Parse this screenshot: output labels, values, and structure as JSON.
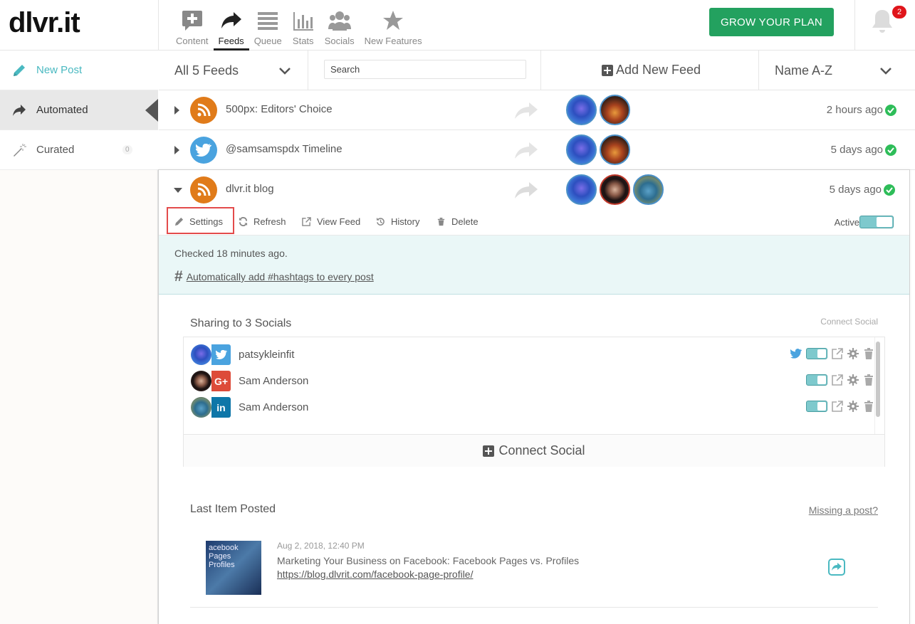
{
  "app": {
    "logo": "dlvr.it"
  },
  "nav": {
    "items": [
      {
        "label": "Content",
        "icon": "content-plus-icon"
      },
      {
        "label": "Feeds",
        "icon": "share-arrow-icon",
        "active": true
      },
      {
        "label": "Queue",
        "icon": "queue-list-icon"
      },
      {
        "label": "Stats",
        "icon": "bar-chart-icon"
      },
      {
        "label": "Socials",
        "icon": "people-icon"
      },
      {
        "label": "New Features",
        "icon": "star-icon"
      }
    ]
  },
  "header": {
    "grow_label": "GROW YOUR PLAN",
    "notification_count": "2"
  },
  "sidebar": {
    "items": [
      {
        "label": "New Post",
        "icon": "pencil-icon"
      },
      {
        "label": "Automated",
        "icon": "share-arrow-icon"
      },
      {
        "label": "Curated",
        "icon": "magic-wand-icon",
        "count": "0"
      }
    ]
  },
  "filters": {
    "all_feeds": "All 5 Feeds",
    "search_placeholder": "Search",
    "add_feed": "Add New Feed",
    "sort": "Name A-Z"
  },
  "feeds": [
    {
      "name": "500px: Editors' Choice",
      "type": "rss",
      "time": "2 hours ago"
    },
    {
      "name": "@samsamspdx Timeline",
      "type": "twitter",
      "time": "5 days ago"
    },
    {
      "name": "dlvr.it blog",
      "type": "rss",
      "time": "5 days ago"
    }
  ],
  "expanded": {
    "actions": {
      "settings": "Settings",
      "refresh": "Refresh",
      "view_feed": "View Feed",
      "history": "History",
      "delete": "Delete",
      "active": "Active"
    },
    "checked": "Checked 18 minutes ago.",
    "hashtag_link": "Automatically add #hashtags to every post",
    "sharing_title": "Sharing to 3 Socials",
    "connect_social_link": "Connect Social",
    "socials": [
      {
        "name": "patsykleinfit",
        "network": "twitter",
        "color": "#4aa3df"
      },
      {
        "name": "Sam Anderson",
        "network": "google-plus",
        "color": "#dd4b39",
        "network_label": "G+"
      },
      {
        "name": "Sam Anderson",
        "network": "linkedin",
        "color": "#0e76a8",
        "network_label": "in"
      }
    ],
    "connect_social_button": "Connect Social",
    "last_item_title": "Last Item Posted",
    "missing_post": "Missing a post?",
    "post": {
      "thumb_text": "acebook Pages Profiles",
      "date": "Aug 2, 2018, 12:40 PM",
      "title": "Marketing Your Business on Facebook: Facebook Pages vs. Profiles",
      "url": "https://blog.dlvrit.com/facebook-page-profile/"
    }
  },
  "colors": {
    "accent": "#4ab9c1",
    "grow": "#23a15f",
    "rss": "#e07b1a",
    "twitter": "#4aa3df",
    "check": "#2ebd59"
  }
}
